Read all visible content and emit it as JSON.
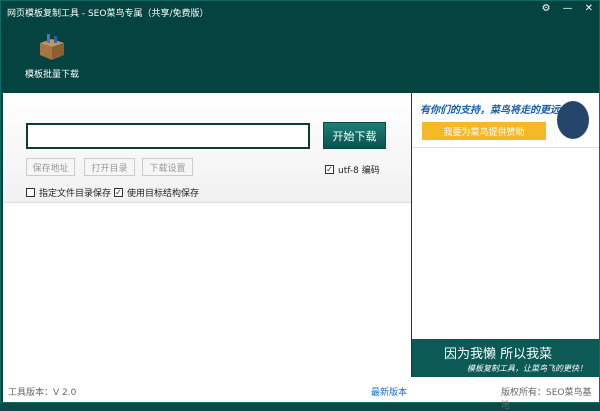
{
  "window": {
    "title": "网页模板复制工具 - SEO菜鸟专属（共享/免费版）",
    "controls": [
      "⚙",
      "—",
      "✕"
    ]
  },
  "toolbar": {
    "batch_download": "模板批量下载"
  },
  "form": {
    "url_value": "",
    "start_download": "开始下载",
    "save_address": "保存地址",
    "open_directory": "打开目录",
    "download_settings": "下载设置",
    "utf8_label": "utf-8 编码",
    "utf8_checked": true,
    "specify_dir_label": "指定文件目录保存",
    "specify_dir_checked": false,
    "keep_structure_label": "使用目标结构保存",
    "keep_structure_checked": true
  },
  "ads": {
    "support_text": "有你们的支持，菜鸟将走的更远",
    "sponsor_button": "我要为菜鸟提供赞助",
    "banner_title": "因为我懒 所以我菜",
    "banner_sub": "模板复制工具，让菜鸟飞的更快！"
  },
  "status": {
    "version": "工具版本：V 2.0",
    "latest": "最新版本",
    "copyright": "版权所有：SEO菜鸟基地"
  },
  "colors": {
    "primary": "#044340",
    "accent": "#f5b829",
    "link": "#1a6fd0"
  }
}
